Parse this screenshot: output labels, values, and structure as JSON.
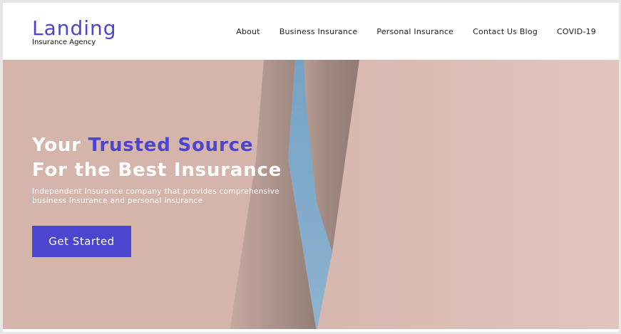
{
  "header": {
    "logo_title": "Landing",
    "logo_subtitle": "Insurance Agency",
    "nav": [
      {
        "label": "About"
      },
      {
        "label": "Business Insurance"
      },
      {
        "label": "Personal Insurance"
      },
      {
        "label": "Contact Us Blog"
      },
      {
        "label": "COVID-19"
      }
    ]
  },
  "hero": {
    "headline_part1": "Your ",
    "headline_accent": "Trusted Source",
    "headline_line2": "For the Best Insurance",
    "subtext": "Independent Insurance company that provides comprehensive business Insurance and personal insurance",
    "cta_label": "Get Started",
    "background_image": "abstract-pink-architecture"
  },
  "colors": {
    "accent": "#4b45cf",
    "hero_bg": "#dcbcb3",
    "sky": "#7aaed0",
    "text_dark": "#222222",
    "text_light": "#ffffff"
  }
}
